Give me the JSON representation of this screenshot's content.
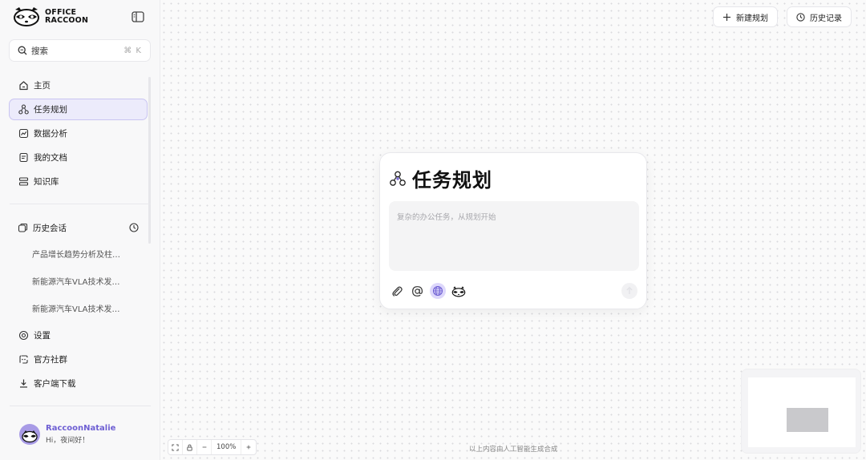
{
  "app": {
    "logo_line1": "OFFICE",
    "logo_line2": "RACCOON",
    "accent_color": "#6e5fd3"
  },
  "search": {
    "label": "搜索",
    "shortcut": "⌘ K"
  },
  "nav": [
    {
      "label": "主页",
      "icon": "home-icon"
    },
    {
      "label": "任务规划",
      "icon": "task-plan-icon",
      "active": true
    },
    {
      "label": "数据分析",
      "icon": "chart-icon"
    },
    {
      "label": "我的文档",
      "icon": "document-icon"
    },
    {
      "label": "知识库",
      "icon": "knowledge-base-icon"
    }
  ],
  "history": {
    "title": "历史会话",
    "items": [
      "产品增长趋势分析及柱…",
      "新能源汽车VLA技术发…",
      "新能源汽车VLA技术发…"
    ]
  },
  "nav_bottom": [
    {
      "label": "设置",
      "icon": "settings-icon"
    },
    {
      "label": "官方社群",
      "icon": "community-icon"
    },
    {
      "label": "客户端下载",
      "icon": "download-icon"
    }
  ],
  "user": {
    "name": "RaccoonNatalie",
    "greeting": "Hi，夜间好！"
  },
  "header": {
    "new_plan": "新建规划",
    "history": "历史记录"
  },
  "card": {
    "title": "任务规划",
    "placeholder": "复杂的办公任务，从规划开始"
  },
  "zoom": {
    "level": "100%"
  },
  "footnote": "以上内容由人工智能生成合成"
}
